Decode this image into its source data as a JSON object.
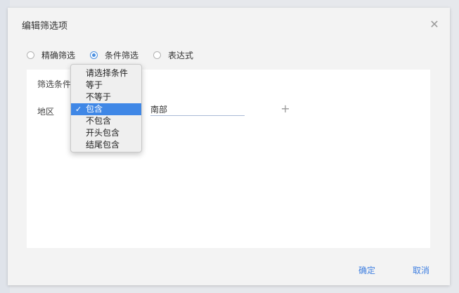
{
  "dialog": {
    "title": "编辑筛选项",
    "close_icon": "close-icon"
  },
  "filter_mode": {
    "options": [
      {
        "label": "精确筛选",
        "checked": false
      },
      {
        "label": "条件筛选",
        "checked": true
      },
      {
        "label": "表达式",
        "checked": false
      }
    ]
  },
  "condition": {
    "section_title": "筛选条件",
    "field_label": "地区",
    "value": "南部",
    "add_icon": "plus-icon"
  },
  "dropdown": {
    "items": [
      {
        "label": "请选择条件",
        "selected": false
      },
      {
        "label": "等于",
        "selected": false
      },
      {
        "label": "不等于",
        "selected": false
      },
      {
        "label": "包含",
        "selected": true
      },
      {
        "label": "不包含",
        "selected": false
      },
      {
        "label": "开头包含",
        "selected": false
      },
      {
        "label": "结尾包含",
        "selected": false
      }
    ],
    "check_glyph": "✓"
  },
  "footer": {
    "ok_label": "确定",
    "cancel_label": "取消"
  },
  "colors": {
    "accent": "#3f87e6",
    "link": "#3f7fe0"
  }
}
